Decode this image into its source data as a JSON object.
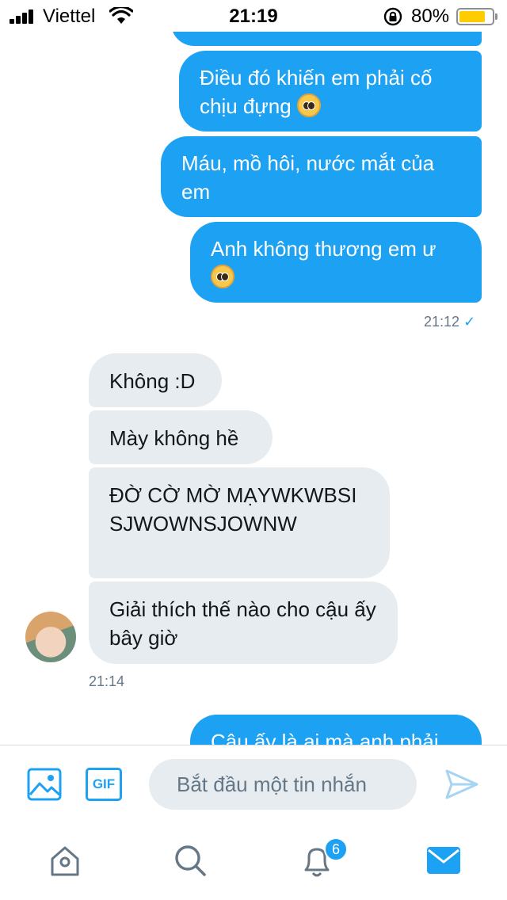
{
  "status_bar": {
    "carrier": "Viettel",
    "time": "21:19",
    "battery_percent": "80%",
    "battery_level": 0.8
  },
  "messages": [
    {
      "text": ""
    },
    {
      "text": "Điều đó khiến em phải cố chịu đựng",
      "emoji": "pleading-face"
    },
    {
      "text": "Máu, mồ hôi, nước mắt của em"
    },
    {
      "text": "Anh không thương em ư",
      "emoji": "pleading-face"
    },
    {
      "text": "Không :D"
    },
    {
      "text": "Mày không hề"
    },
    {
      "text": "ĐỜ CỜ MỜ MẠYWKWBSISJWOWNSJOWNW"
    },
    {
      "text": "Giải thích thế nào cho cậu ấy bây giờ"
    },
    {
      "text": "Cậu ấy là ai mà anh phải"
    }
  ],
  "meta": {
    "sent_time": "21:12",
    "received_time": "21:14"
  },
  "composer": {
    "placeholder": "Bắt đầu một tin nhắn",
    "gif_label": "GIF"
  },
  "tabbar": {
    "notifications_badge": "6"
  },
  "colors": {
    "accent": "#1da1f2",
    "incoming_bubble": "#e6ecf0",
    "meta_text": "#657786"
  }
}
